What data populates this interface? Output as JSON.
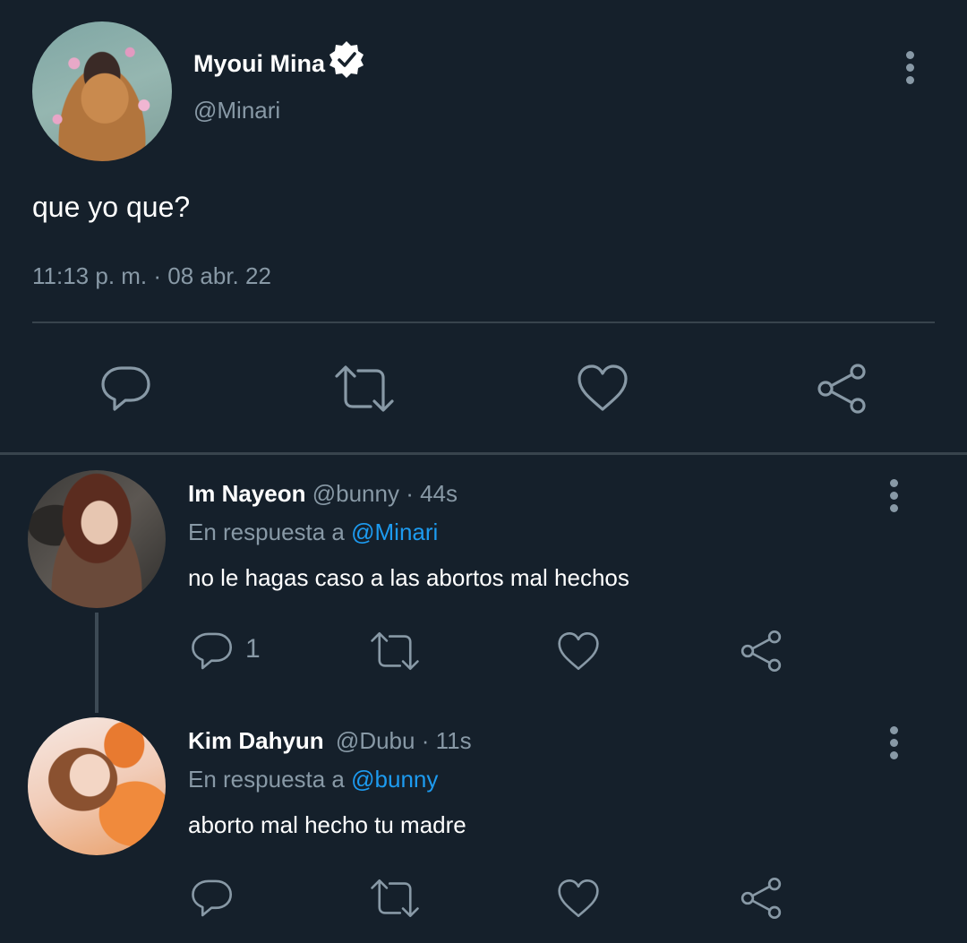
{
  "main_tweet": {
    "display_name": "Myoui Mina",
    "handle": "@Minari",
    "verified": true,
    "text": "que yo que?",
    "timestamp": "11:13 p. m. · 08 abr. 22",
    "avatar_icon": "avatar-photo"
  },
  "replies": [
    {
      "display_name": "Im Nayeon",
      "handle": "@bunny",
      "time": "· 44s",
      "reply_prefix": "En respuesta a",
      "reply_to": "@Minari",
      "text": "no le hagas caso a las abortos mal hechos",
      "reply_count": "1"
    },
    {
      "display_name": "Kim Dahyun",
      "handle": "@Dubu",
      "time": "· 11s",
      "reply_prefix": "En respuesta a",
      "reply_to": "@bunny",
      "text": "aborto mal hecho tu madre",
      "reply_count": ""
    }
  ],
  "colors": {
    "background": "#15202b",
    "secondary_text": "#8899a6",
    "link": "#1d9bf0",
    "divider": "#38444d"
  },
  "icons": [
    "reply-icon",
    "retweet-icon",
    "like-icon",
    "share-icon",
    "more-options-icon",
    "verified-badge-icon"
  ]
}
